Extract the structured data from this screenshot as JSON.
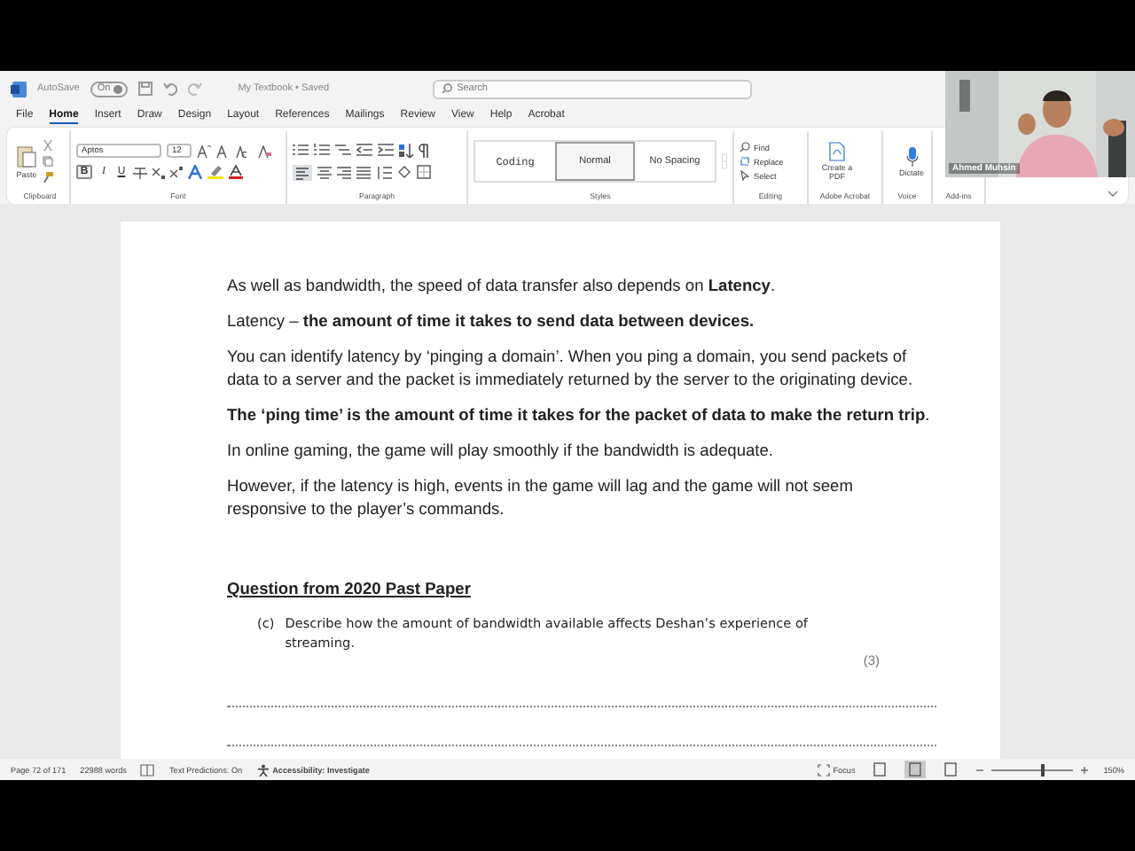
{
  "title_bar": {
    "autosave_label": "AutoSave",
    "autosave_state": "On",
    "document_title": "My Textbook • Saved",
    "search": {
      "placeholder": "Search"
    }
  },
  "tabs": [
    {
      "label": "File",
      "selected": false
    },
    {
      "label": "Home",
      "selected": true
    },
    {
      "label": "Insert",
      "selected": false
    },
    {
      "label": "Draw",
      "selected": false
    },
    {
      "label": "Design",
      "selected": false
    },
    {
      "label": "Layout",
      "selected": false
    },
    {
      "label": "References",
      "selected": false
    },
    {
      "label": "Mailings",
      "selected": false
    },
    {
      "label": "Review",
      "selected": false
    },
    {
      "label": "View",
      "selected": false
    },
    {
      "label": "Help",
      "selected": false
    },
    {
      "label": "Acrobat",
      "selected": false
    }
  ],
  "ribbon": {
    "clipboard": {
      "paste": "Paste",
      "label": "Clipboard"
    },
    "font": {
      "font_name": "Aptos",
      "font_size": "12",
      "format_buttons": [
        "B",
        "I",
        "U"
      ],
      "label": "Font"
    },
    "paragraph": {
      "label": "Paragraph"
    },
    "styles": {
      "items": [
        {
          "label": "Coding",
          "kind": "mono",
          "selected": false
        },
        {
          "label": "Normal",
          "kind": "plain",
          "selected": true
        },
        {
          "label": "No Spacing",
          "kind": "plain",
          "selected": false
        }
      ],
      "label": "Styles"
    },
    "editing": {
      "items": [
        "Find",
        "Replace",
        "Select"
      ],
      "label": "Editing"
    },
    "acrobat": {
      "button": "Create a PDF",
      "label": "Adobe Acrobat"
    },
    "voice": {
      "button": "Dictate",
      "label": "Voice"
    },
    "addins": {
      "label": "Add-ins"
    }
  },
  "webcam": {
    "kind": "picture",
    "name_label": "Ahmed Muhsin"
  },
  "document": {
    "paragraphs": [
      {
        "kind": "body",
        "text": "As well as bandwidth, the speed of data transfer also depends on **Latency**."
      },
      {
        "kind": "body",
        "text": "Latency – **the amount of time it takes to send data between devices.**"
      },
      {
        "kind": "body",
        "text": "You can identify latency by ‘pinging a domain’. When you ping a domain, you send packets of data to a server and the packet is immediately returned by the server to the originating device."
      },
      {
        "kind": "body",
        "text": "**The ‘ping time’ is the amount of time it takes for the packet of data to make the return trip**."
      },
      {
        "kind": "body",
        "text": "In online gaming, the game will play smoothly if the bandwidth is adequate."
      },
      {
        "kind": "body",
        "text": "However, if the latency is high, events in the game will lag and the game will not seem responsive to the player’s commands."
      },
      {
        "kind": "heading",
        "text": "Question from 2020 Past Paper"
      }
    ],
    "question": {
      "number": "(c)",
      "text": "Describe how the amount of bandwidth available affects Deshan’s experience of streaming.",
      "marks": "(3)"
    }
  },
  "status_bar": {
    "page": "Page 72 of 171",
    "words": "22988 words",
    "text_predictions": "Text Predictions: On",
    "accessibility": "Accessibility: Investigate",
    "focus": "Focus",
    "views": [
      {
        "selected": false
      },
      {
        "selected": true
      },
      {
        "selected": false
      }
    ],
    "zoom": {
      "level": 0.62,
      "reading": "150%"
    }
  }
}
